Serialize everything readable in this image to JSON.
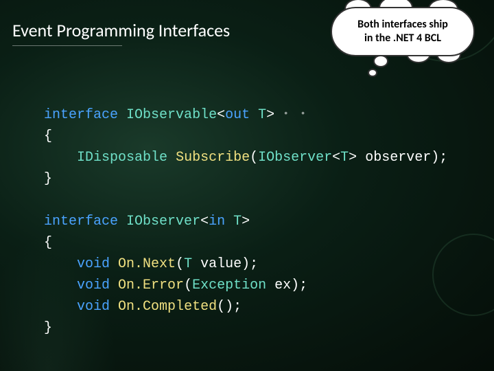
{
  "title": "Event Programming Interfaces",
  "callout": {
    "line1": "Both interfaces ship",
    "line2": "in the .NET 4 BCL"
  },
  "code": {
    "kw_interface": "interface",
    "kw_out": "out",
    "kw_in": "in",
    "kw_void": "void",
    "t_iobservable": "IObservable",
    "t_idisposable": "IDisposable",
    "t_iobserver": "IObserver",
    "t_exception": "Exception",
    "m_subscribe": "Subscribe",
    "m_onnext": "On.Next",
    "m_onerror": "On.Error",
    "m_oncompleted": "On.Completed",
    "g_T": "T",
    "p_observer": " observer);",
    "p_value": " value);",
    "p_ex": " ex);",
    "p_none": "();",
    "lt": "<",
    "gt": ">",
    "brace_open": "{",
    "brace_close": "}",
    "paren_open": "(",
    "dots": " • •"
  }
}
